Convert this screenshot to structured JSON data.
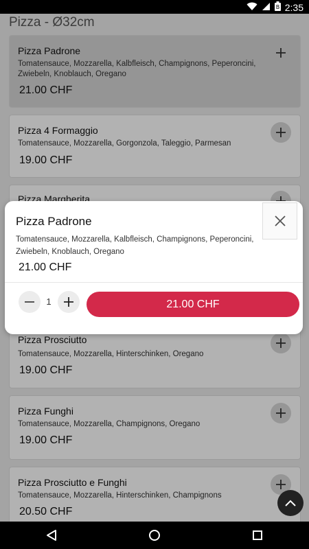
{
  "status_bar": {
    "time": "2:35"
  },
  "page": {
    "title": "Pizza - Ø32cm"
  },
  "items": [
    {
      "name": "Pizza Padrone",
      "desc": "Tomatensauce, Mozzarella, Kalbfleisch, Champignons, Peperoncini, Zwiebeln, Knoblauch, Oregano",
      "price": "21.00 CHF"
    },
    {
      "name": "Pizza 4 Formaggio",
      "desc": "Tomatensauce, Mozzarella, Gorgonzola, Taleggio, Parmesan",
      "price": "19.00 CHF"
    },
    {
      "name": "Pizza Margherita",
      "desc": "",
      "price": ""
    },
    {
      "name": "Pizza Prosciutto",
      "desc": "Tomatensauce, Mozzarella, Hinterschinken, Oregano",
      "price": "19.00 CHF"
    },
    {
      "name": "Pizza Funghi",
      "desc": "Tomatensauce, Mozzarella, Champignons, Oregano",
      "price": "19.00 CHF"
    },
    {
      "name": "Pizza Prosciutto e Funghi",
      "desc": "Tomatensauce, Mozzarella, Hinterschinken, Champignons",
      "price": "20.50 CHF"
    }
  ],
  "modal": {
    "title": "Pizza Padrone",
    "desc_line1": "Tomatensauce, Mozzarella, Kalbfleisch, Champignons, Peperoncini,",
    "desc_line2": "Zwiebeln, Knoblauch, Oregano",
    "price": "21.00 CHF",
    "quantity": "1",
    "add_button_label": "21.00 CHF"
  },
  "colors": {
    "accent": "#d3294a"
  }
}
